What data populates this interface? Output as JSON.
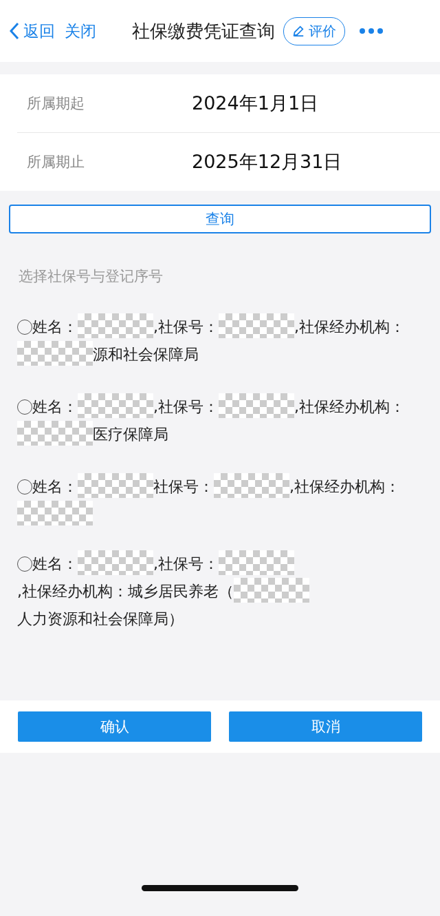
{
  "nav": {
    "back": "返回",
    "close": "关闭",
    "title": "社保缴费凭证查询",
    "rate": "评价"
  },
  "period": [
    {
      "label": "所属期起",
      "value": "2024年1月1日"
    },
    {
      "label": "所属期止",
      "value": "2025年12月31日"
    }
  ],
  "query_button": "查询",
  "section_label": "选择社保号与登记序号",
  "options": [
    {
      "selected": false,
      "parts": [
        {
          "kind": "text",
          "text": "姓名："
        },
        {
          "kind": "redacted"
        },
        {
          "kind": "text",
          "text": ",社保号："
        },
        {
          "kind": "redacted"
        },
        {
          "kind": "text",
          "text": ",社保经办机构："
        },
        {
          "kind": "redacted"
        },
        {
          "kind": "text",
          "text": "源和社会保障局"
        }
      ]
    },
    {
      "selected": false,
      "parts": [
        {
          "kind": "text",
          "text": "姓名："
        },
        {
          "kind": "redacted"
        },
        {
          "kind": "text",
          "text": ",社保号："
        },
        {
          "kind": "redacted"
        },
        {
          "kind": "text",
          "text": ",社保经办机构："
        },
        {
          "kind": "redacted"
        },
        {
          "kind": "text",
          "text": "医疗保障局"
        }
      ]
    },
    {
      "selected": false,
      "parts": [
        {
          "kind": "text",
          "text": "姓名："
        },
        {
          "kind": "redacted"
        },
        {
          "kind": "text",
          "text": "社保号："
        },
        {
          "kind": "redacted"
        },
        {
          "kind": "text",
          "text": ",社保经办机构："
        },
        {
          "kind": "redacted"
        }
      ]
    },
    {
      "selected": false,
      "parts": [
        {
          "kind": "text",
          "text": "姓名："
        },
        {
          "kind": "redacted"
        },
        {
          "kind": "text",
          "text": ",社保号："
        },
        {
          "kind": "redacted"
        },
        {
          "kind": "text",
          "text": ",社保经办机构：城乡居民养老（"
        },
        {
          "kind": "redacted"
        },
        {
          "kind": "text",
          "text": "人力资源和社会保障局）"
        }
      ]
    }
  ],
  "buttons": [
    {
      "label": "确认"
    },
    {
      "label": "取消"
    }
  ]
}
